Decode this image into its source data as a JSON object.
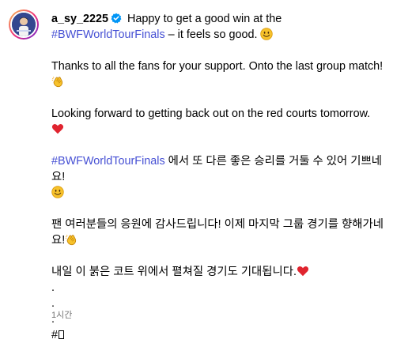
{
  "post": {
    "username": "a_sy_2225",
    "timestamp": "1시간",
    "colors": {
      "hashtag": "#4650d4",
      "verified": "#0095f6",
      "timestamp": "#737373"
    },
    "caption": {
      "line1_text": " Happy to get a good win at the ",
      "hashtag_1": "#BWFWorldTourFinals",
      "line1_tail": " – it feels so good. ",
      "emoji_smile_1": "smiling-face-emoji",
      "para2_text": "Thanks to all the fans for your support. Onto the last group match!",
      "emoji_clap_1": "clapping-hands-emoji",
      "para3_text": "Looking forward to getting back out on the red courts tomorrow.",
      "emoji_heart_1": "red-heart-emoji",
      "hashtag_2": "#BWFWorldTourFinals",
      "para4_text": " 에서 또 다른 좋은 승리를 거둘 수 있어 기쁘네요!",
      "emoji_smile_2": "smiling-face-emoji",
      "para5_text": "팬 여러분들의 응원에 감사드립니다! 이제 마지막 그룹 경기를 향해가네요!",
      "emoji_clap_2": "clapping-hands-emoji",
      "para6_text": "내일 이 붉은 코트 위에서 펼쳐질 경기도 기대됩니다.",
      "emoji_heart_2": "red-heart-emoji",
      "dot_1": ".",
      "dot_2": ".",
      "dot_3": ".",
      "final_tag": "#"
    }
  }
}
